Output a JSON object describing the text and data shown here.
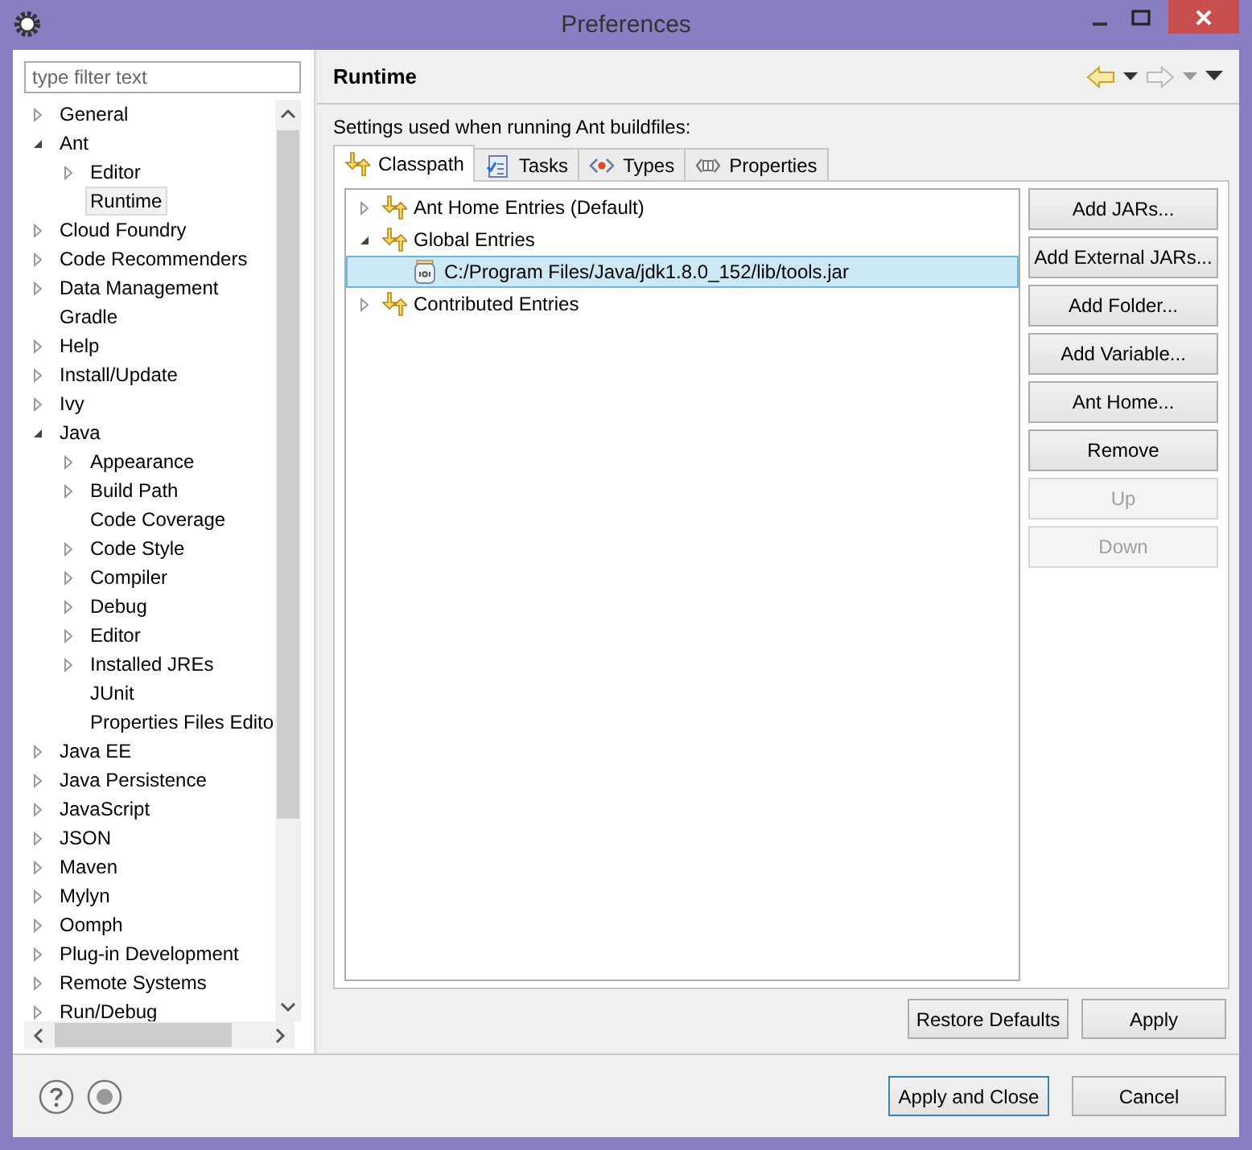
{
  "window": {
    "title": "Preferences"
  },
  "filter": {
    "placeholder": "type filter text"
  },
  "tree": [
    {
      "label": "General",
      "kind": "branch",
      "expanded": false,
      "selected": false
    },
    {
      "label": "Ant",
      "kind": "branch",
      "expanded": true,
      "selected": false,
      "children": [
        {
          "label": "Editor",
          "kind": "branch",
          "expanded": false,
          "selected": false
        },
        {
          "label": "Runtime",
          "kind": "leaf",
          "selected": true
        }
      ]
    },
    {
      "label": "Cloud Foundry",
      "kind": "branch",
      "expanded": false,
      "selected": false
    },
    {
      "label": "Code Recommenders",
      "kind": "branch",
      "expanded": false,
      "selected": false
    },
    {
      "label": "Data Management",
      "kind": "branch",
      "expanded": false,
      "selected": false
    },
    {
      "label": "Gradle",
      "kind": "leaf",
      "selected": false
    },
    {
      "label": "Help",
      "kind": "branch",
      "expanded": false,
      "selected": false
    },
    {
      "label": "Install/Update",
      "kind": "branch",
      "expanded": false,
      "selected": false
    },
    {
      "label": "Ivy",
      "kind": "branch",
      "expanded": false,
      "selected": false
    },
    {
      "label": "Java",
      "kind": "branch",
      "expanded": true,
      "selected": false,
      "children": [
        {
          "label": "Appearance",
          "kind": "branch",
          "expanded": false,
          "selected": false
        },
        {
          "label": "Build Path",
          "kind": "branch",
          "expanded": false,
          "selected": false
        },
        {
          "label": "Code Coverage",
          "kind": "leaf",
          "selected": false
        },
        {
          "label": "Code Style",
          "kind": "branch",
          "expanded": false,
          "selected": false
        },
        {
          "label": "Compiler",
          "kind": "branch",
          "expanded": false,
          "selected": false
        },
        {
          "label": "Debug",
          "kind": "branch",
          "expanded": false,
          "selected": false
        },
        {
          "label": "Editor",
          "kind": "branch",
          "expanded": false,
          "selected": false
        },
        {
          "label": "Installed JREs",
          "kind": "branch",
          "expanded": false,
          "selected": false
        },
        {
          "label": "JUnit",
          "kind": "leaf",
          "selected": false
        },
        {
          "label": "Properties Files Edito",
          "kind": "leaf",
          "selected": false
        }
      ]
    },
    {
      "label": "Java EE",
      "kind": "branch",
      "expanded": false,
      "selected": false
    },
    {
      "label": "Java Persistence",
      "kind": "branch",
      "expanded": false,
      "selected": false
    },
    {
      "label": "JavaScript",
      "kind": "branch",
      "expanded": false,
      "selected": false
    },
    {
      "label": "JSON",
      "kind": "branch",
      "expanded": false,
      "selected": false
    },
    {
      "label": "Maven",
      "kind": "branch",
      "expanded": false,
      "selected": false
    },
    {
      "label": "Mylyn",
      "kind": "branch",
      "expanded": false,
      "selected": false
    },
    {
      "label": "Oomph",
      "kind": "branch",
      "expanded": false,
      "selected": false
    },
    {
      "label": "Plug-in Development",
      "kind": "branch",
      "expanded": false,
      "selected": false
    },
    {
      "label": "Remote Systems",
      "kind": "branch",
      "expanded": false,
      "selected": false
    },
    {
      "label": "Run/Debug",
      "kind": "branch",
      "expanded": false,
      "selected": false
    }
  ],
  "page": {
    "title": "Runtime",
    "description": "Settings used when running Ant buildfiles:"
  },
  "tabs": [
    {
      "label": "Classpath",
      "selected": true
    },
    {
      "label": "Tasks",
      "selected": false
    },
    {
      "label": "Types",
      "selected": false
    },
    {
      "label": "Properties",
      "selected": false
    }
  ],
  "classpath": [
    {
      "label": "Ant Home Entries (Default)",
      "kind": "group",
      "expanded": false,
      "selected": false
    },
    {
      "label": "Global Entries",
      "kind": "group",
      "expanded": true,
      "selected": false,
      "children": [
        {
          "label": "C:/Program Files/Java/jdk1.8.0_152/lib/tools.jar",
          "kind": "jar",
          "selected": true
        }
      ]
    },
    {
      "label": "Contributed Entries",
      "kind": "group",
      "expanded": false,
      "selected": false
    }
  ],
  "side_buttons": [
    {
      "label": "Add JARs...",
      "disabled": false
    },
    {
      "label": "Add External JARs...",
      "disabled": false
    },
    {
      "label": "Add Folder...",
      "disabled": false
    },
    {
      "label": "Add Variable...",
      "disabled": false
    },
    {
      "label": "Ant Home...",
      "disabled": false
    },
    {
      "label": "Remove",
      "disabled": false
    },
    {
      "label": "Up",
      "disabled": true
    },
    {
      "label": "Down",
      "disabled": true
    }
  ],
  "page_buttons": [
    "Restore Defaults",
    "Apply"
  ],
  "dialog_buttons": [
    {
      "label": "Apply and Close",
      "default": true
    },
    {
      "label": "Cancel",
      "default": false
    }
  ]
}
